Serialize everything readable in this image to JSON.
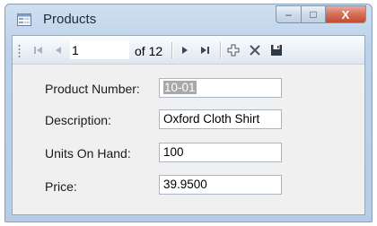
{
  "window": {
    "title": "Products"
  },
  "caption": {
    "minimize": "–",
    "maximize": "□",
    "close": "X"
  },
  "navigator": {
    "position": "1",
    "count_label": "of 12",
    "icons": [
      "move-first-icon",
      "move-previous-icon",
      "move-next-icon",
      "move-last-icon",
      "add-new-icon",
      "delete-icon",
      "save-icon"
    ]
  },
  "form": {
    "product_number": {
      "label": "Product Number:",
      "value": "10-01"
    },
    "description": {
      "label": "Description:",
      "value": "Oxford Cloth Shirt"
    },
    "units_on_hand": {
      "label": "Units On Hand:",
      "value": "100"
    },
    "price": {
      "label": "Price:",
      "value": "39.9500"
    }
  }
}
